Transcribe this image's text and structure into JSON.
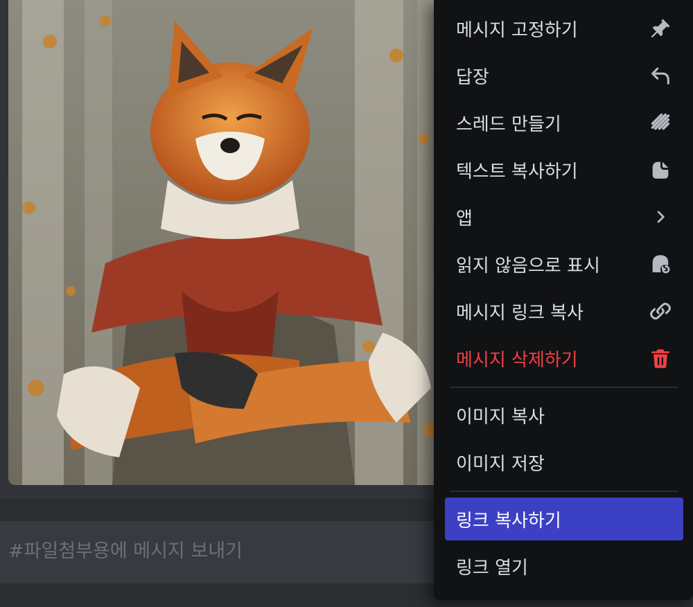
{
  "attachment": {
    "alt": "fox illustration"
  },
  "composer": {
    "placeholder": "#파일첨부용에 메시지 보내기"
  },
  "context_menu": {
    "items": [
      {
        "label": "메시지 고정하기",
        "icon": "pin-icon"
      },
      {
        "label": "답장",
        "icon": "reply-icon"
      },
      {
        "label": "스레드 만들기",
        "icon": "thread-icon"
      },
      {
        "label": "텍스트 복사하기",
        "icon": "copy-text-icon"
      },
      {
        "label": "앱",
        "icon": "chevron-right-icon"
      },
      {
        "label": "읽지 않음으로 표시",
        "icon": "mark-unread-icon"
      },
      {
        "label": "메시지 링크 복사",
        "icon": "link-icon"
      },
      {
        "label": "메시지 삭제하기",
        "icon": "trash-icon",
        "color": "#f23f43"
      }
    ],
    "image_items": [
      {
        "label": "이미지 복사"
      },
      {
        "label": "이미지 저장"
      }
    ],
    "link_items": [
      {
        "label": "링크 복사하기",
        "highlighted": true
      },
      {
        "label": "링크 열기"
      }
    ],
    "accent": "#3c40c4"
  }
}
